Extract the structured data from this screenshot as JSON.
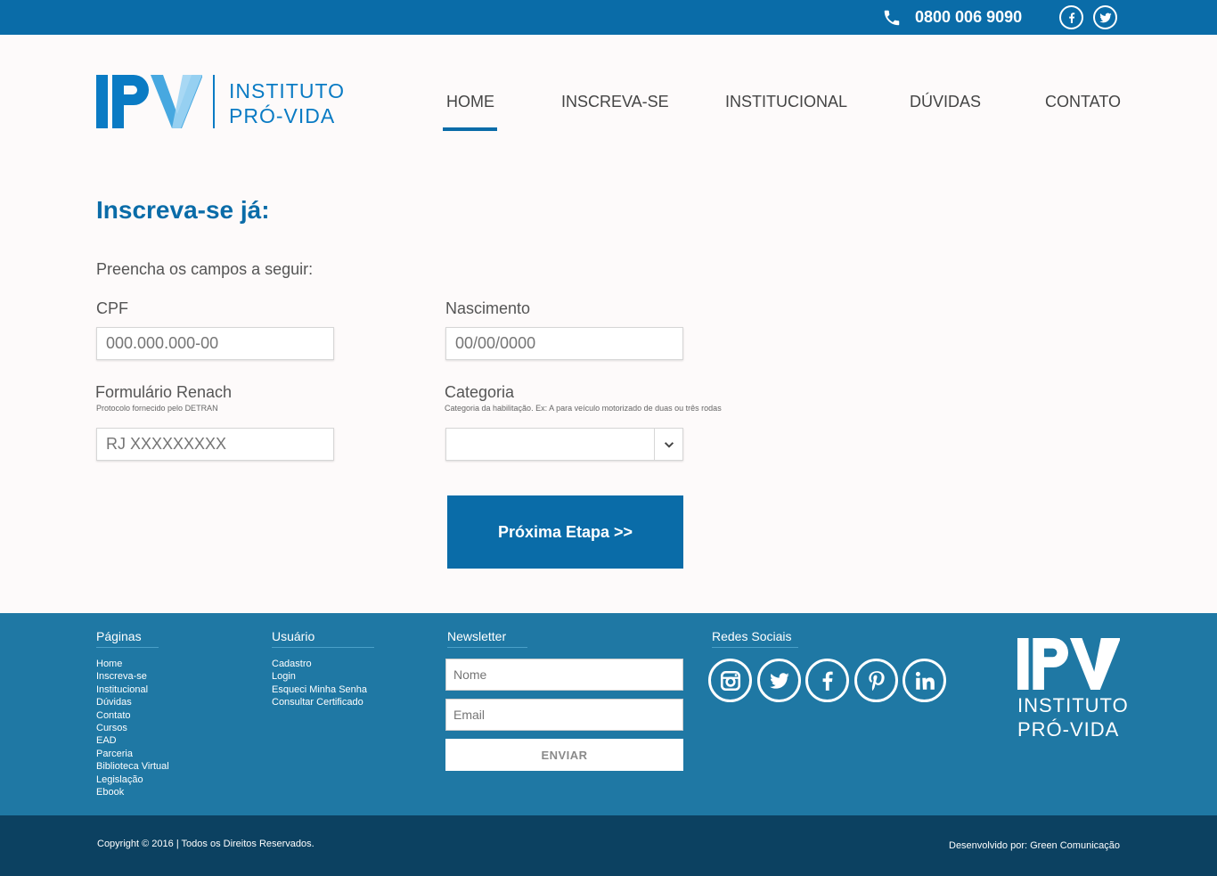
{
  "topbar": {
    "phone": "0800 006 9090",
    "icons": [
      "phone-icon",
      "facebook-icon",
      "twitter-icon"
    ]
  },
  "header": {
    "logo_mark": "IPV",
    "logo_line1": "INSTITUTO",
    "logo_line2": "PRÓ-VIDA",
    "nav": [
      {
        "label": "HOME",
        "active": true
      },
      {
        "label": "INSCREVA-SE"
      },
      {
        "label": "INSTITUCIONAL"
      },
      {
        "label": "DÚVIDAS"
      },
      {
        "label": "CONTATO"
      }
    ]
  },
  "form": {
    "title": "Inscreva-se já:",
    "intro": "Preencha os campos a seguir:",
    "cpf": {
      "label": "CPF",
      "placeholder": "000.000.000-00"
    },
    "nascimento": {
      "label": "Nascimento",
      "placeholder": "00/00/0000"
    },
    "renach": {
      "label": "Formulário Renach",
      "hint": "Protocolo fornecido pelo DETRAN",
      "placeholder": "RJ XXXXXXXXX"
    },
    "categoria": {
      "label": "Categoria",
      "hint": "Categoria da habilitação. Ex: A para veículo motorizado de duas ou três rodas",
      "value": ""
    },
    "next_label": "Próxima Etapa >>"
  },
  "footer": {
    "pages": {
      "title": "Páginas",
      "items": [
        "Home",
        "Inscreva-se",
        "Institucional",
        "Dúvidas",
        "Contato",
        "Cursos",
        "EAD",
        "Parceria",
        "Biblioteca Virtual",
        "Legislação",
        "Ebook"
      ]
    },
    "user": {
      "title": "Usuário",
      "items": [
        "Cadastro",
        "Login",
        "Esqueci Minha Senha",
        "Consultar Certificado"
      ]
    },
    "newsletter": {
      "title": "Newsletter",
      "name_placeholder": "Nome",
      "email_placeholder": "Email",
      "submit_label": "ENVIAR"
    },
    "social": {
      "title": "Redes Sociais",
      "icons": [
        "instagram-icon",
        "twitter-icon",
        "facebook-icon",
        "pinterest-icon",
        "linkedin-icon"
      ]
    },
    "logo_mark": "IPV",
    "logo_line1": "INSTITUTO",
    "logo_line2": "PRÓ-VIDA"
  },
  "bottom": {
    "copyright": "Copyright © 2016 | Todos os Direitos Reservados.",
    "developer": "Desenvolvido por: Green Comunicação"
  },
  "colors": {
    "primary": "#0a6ca8",
    "footer": "#1f78a4",
    "bottombar": "#0c4161",
    "background": "#fdfafa"
  }
}
